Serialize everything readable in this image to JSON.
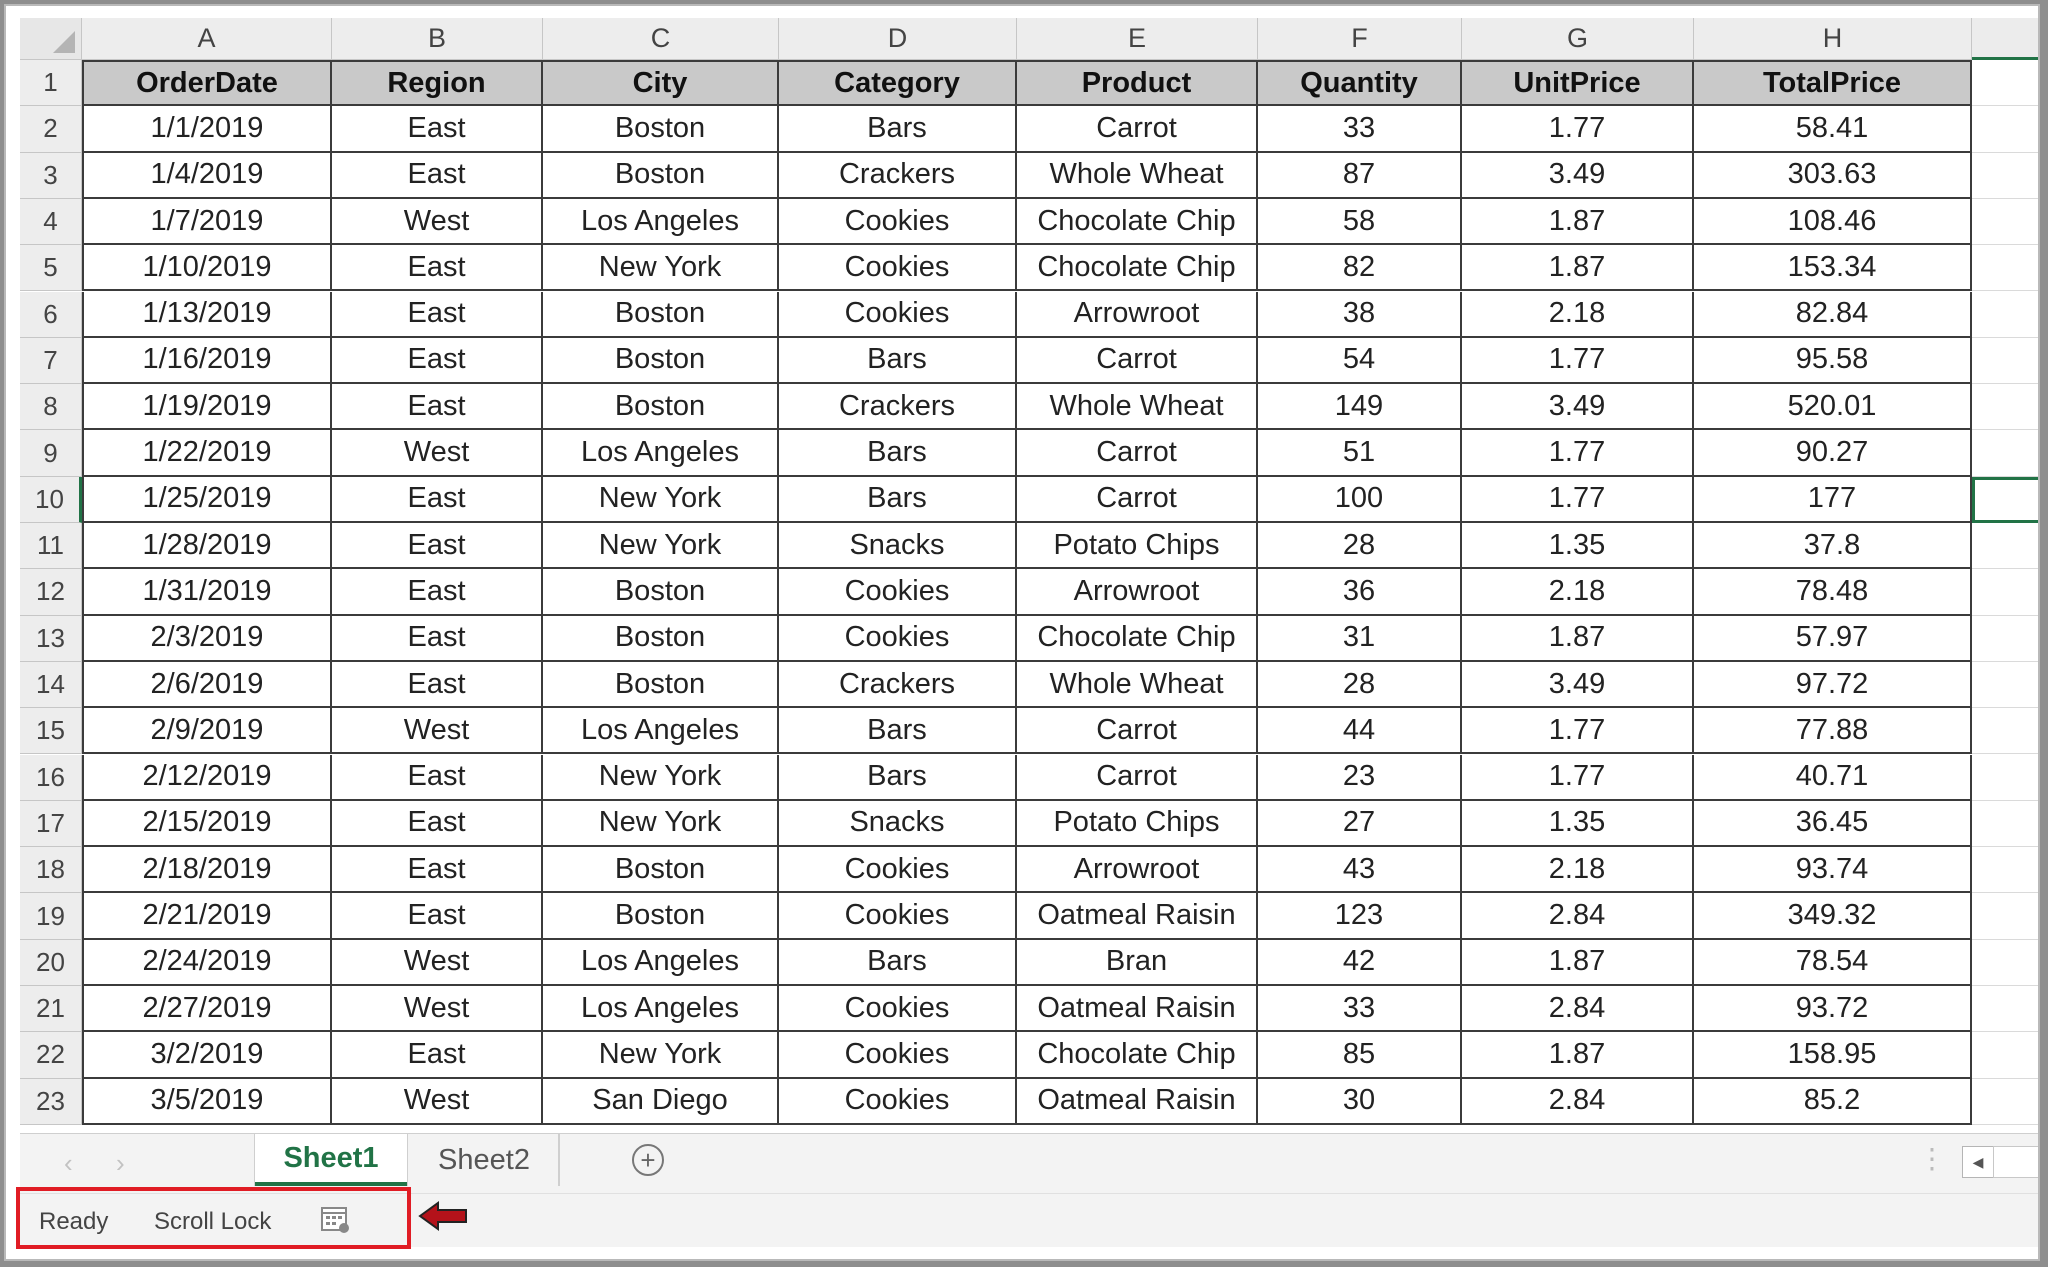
{
  "columns": [
    "A",
    "B",
    "C",
    "D",
    "E",
    "F",
    "G",
    "H"
  ],
  "headers": [
    "OrderDate",
    "Region",
    "City",
    "Category",
    "Product",
    "Quantity",
    "UnitPrice",
    "TotalPrice"
  ],
  "rows": [
    [
      "1/1/2019",
      "East",
      "Boston",
      "Bars",
      "Carrot",
      "33",
      "1.77",
      "58.41"
    ],
    [
      "1/4/2019",
      "East",
      "Boston",
      "Crackers",
      "Whole Wheat",
      "87",
      "3.49",
      "303.63"
    ],
    [
      "1/7/2019",
      "West",
      "Los Angeles",
      "Cookies",
      "Chocolate Chip",
      "58",
      "1.87",
      "108.46"
    ],
    [
      "1/10/2019",
      "East",
      "New York",
      "Cookies",
      "Chocolate Chip",
      "82",
      "1.87",
      "153.34"
    ],
    [
      "1/13/2019",
      "East",
      "Boston",
      "Cookies",
      "Arrowroot",
      "38",
      "2.18",
      "82.84"
    ],
    [
      "1/16/2019",
      "East",
      "Boston",
      "Bars",
      "Carrot",
      "54",
      "1.77",
      "95.58"
    ],
    [
      "1/19/2019",
      "East",
      "Boston",
      "Crackers",
      "Whole Wheat",
      "149",
      "3.49",
      "520.01"
    ],
    [
      "1/22/2019",
      "West",
      "Los Angeles",
      "Bars",
      "Carrot",
      "51",
      "1.77",
      "90.27"
    ],
    [
      "1/25/2019",
      "East",
      "New York",
      "Bars",
      "Carrot",
      "100",
      "1.77",
      "177"
    ],
    [
      "1/28/2019",
      "East",
      "New York",
      "Snacks",
      "Potato Chips",
      "28",
      "1.35",
      "37.8"
    ],
    [
      "1/31/2019",
      "East",
      "Boston",
      "Cookies",
      "Arrowroot",
      "36",
      "2.18",
      "78.48"
    ],
    [
      "2/3/2019",
      "East",
      "Boston",
      "Cookies",
      "Chocolate Chip",
      "31",
      "1.87",
      "57.97"
    ],
    [
      "2/6/2019",
      "East",
      "Boston",
      "Crackers",
      "Whole Wheat",
      "28",
      "3.49",
      "97.72"
    ],
    [
      "2/9/2019",
      "West",
      "Los Angeles",
      "Bars",
      "Carrot",
      "44",
      "1.77",
      "77.88"
    ],
    [
      "2/12/2019",
      "East",
      "New York",
      "Bars",
      "Carrot",
      "23",
      "1.77",
      "40.71"
    ],
    [
      "2/15/2019",
      "East",
      "New York",
      "Snacks",
      "Potato Chips",
      "27",
      "1.35",
      "36.45"
    ],
    [
      "2/18/2019",
      "East",
      "Boston",
      "Cookies",
      "Arrowroot",
      "43",
      "2.18",
      "93.74"
    ],
    [
      "2/21/2019",
      "East",
      "Boston",
      "Cookies",
      "Oatmeal Raisin",
      "123",
      "2.84",
      "349.32"
    ],
    [
      "2/24/2019",
      "West",
      "Los Angeles",
      "Bars",
      "Bran",
      "42",
      "1.87",
      "78.54"
    ],
    [
      "2/27/2019",
      "West",
      "Los Angeles",
      "Cookies",
      "Oatmeal Raisin",
      "33",
      "2.84",
      "93.72"
    ],
    [
      "3/2/2019",
      "East",
      "New York",
      "Cookies",
      "Chocolate Chip",
      "85",
      "1.87",
      "158.95"
    ],
    [
      "3/5/2019",
      "West",
      "San Diego",
      "Cookies",
      "Oatmeal Raisin",
      "30",
      "2.84",
      "85.2"
    ]
  ],
  "row_numbers": [
    "1",
    "2",
    "3",
    "4",
    "5",
    "6",
    "7",
    "8",
    "9",
    "10",
    "11",
    "12",
    "13",
    "14",
    "15",
    "16",
    "17",
    "18",
    "19",
    "20",
    "21",
    "22",
    "23"
  ],
  "active_row": "10",
  "sheets": {
    "tabs": [
      "Sheet1",
      "Sheet2"
    ],
    "active": "Sheet1",
    "add_icon": "plus-circle-icon"
  },
  "status": {
    "ready": "Ready",
    "scroll_lock": "Scroll Lock",
    "macro_icon": "macro-record-icon"
  },
  "colors": {
    "accent": "#217346",
    "highlight": "#e01c24",
    "arrow": "#b4121a"
  }
}
